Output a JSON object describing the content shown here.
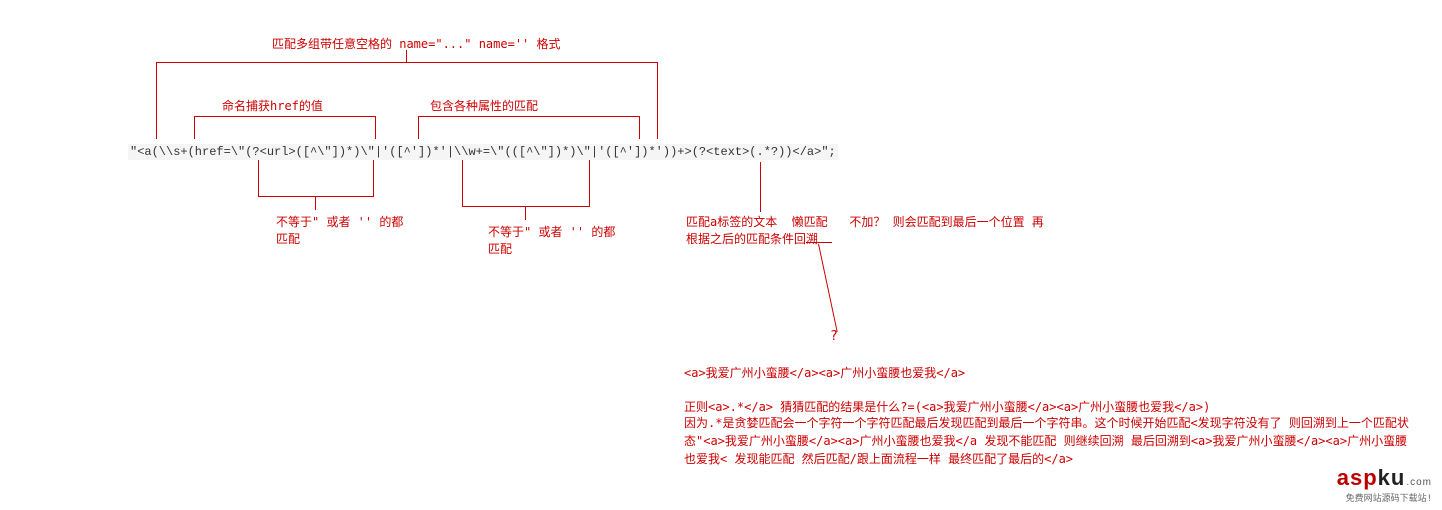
{
  "top_annotation": "匹配多组带任意空格的 name=\"...\" name='' 格式",
  "named_capture": "命名捕获href的值",
  "attr_match": "包含各种属性的匹配",
  "regex": "\"<a(\\\\s+(href=\\\"(?<url>([^\\\"])*)\\\"|'([^'])*'|\\\\w+=\\\"(([^\\\"])*)\\\"|'([^'])*'))+>(?<text>(.*?))</a>\";",
  "not_quote_1": "不等于\" 或者 '' 的都\n匹配",
  "not_quote_2": "不等于\" 或者 '' 的都\n匹配",
  "lazy_text": "匹配a标签的文本  懒匹配   不加？ 则会匹配到最后一个位置 再\n根据之后的匹配条件回溯",
  "question_mark": "?",
  "example_line": "<a>我爱广州小蛮腰</a><a>广州小蛮腰也爱我</a>",
  "explain_1": "正则<a>.*</a>   猜猜匹配的结果是什么?=(<a>我爱广州小蛮腰</a><a>广州小蛮腰也爱我</a>)",
  "explain_2": "因为.*是贪婪匹配会一个字符一个字符匹配最后发现匹配到最后一个字符串。这个时候开始匹配<发现字符没有了 则回溯到上一个匹配状态\"<a>我爱广州小蛮腰</a><a>广州小蛮腰也爱我</a   发现不能匹配 则继续回溯 最后回溯到<a>我爱广州小蛮腰</a><a>广州小蛮腰也爱我< 发现能匹配 然后匹配/跟上面流程一样 最终匹配了最后的</a>",
  "watermark_text": "aspku",
  "watermark_com": ".com",
  "watermark_sub": "免费网站源码下载站!"
}
